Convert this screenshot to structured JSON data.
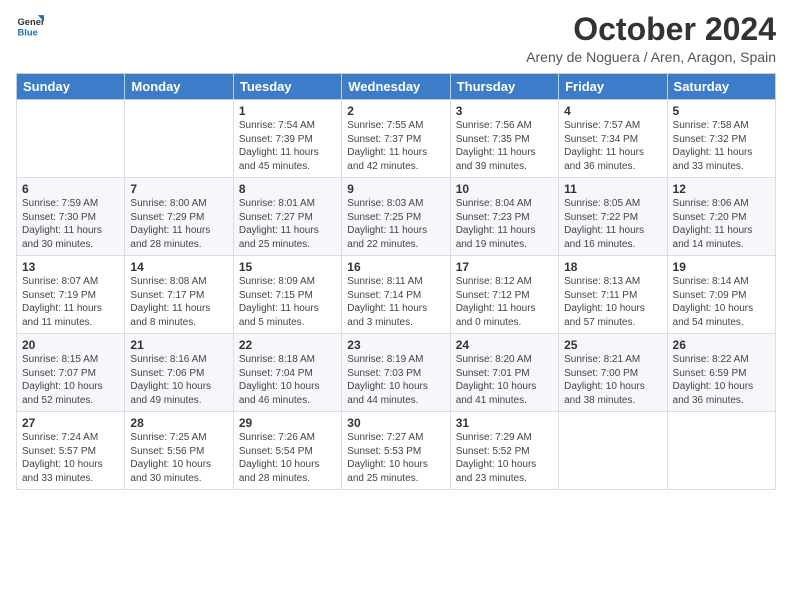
{
  "logo": {
    "line1": "General",
    "line2": "Blue"
  },
  "title": "October 2024",
  "subtitle": "Areny de Noguera / Aren, Aragon, Spain",
  "days_of_week": [
    "Sunday",
    "Monday",
    "Tuesday",
    "Wednesday",
    "Thursday",
    "Friday",
    "Saturday"
  ],
  "weeks": [
    [
      {
        "day": "",
        "info": ""
      },
      {
        "day": "",
        "info": ""
      },
      {
        "day": "1",
        "info": "Sunrise: 7:54 AM\nSunset: 7:39 PM\nDaylight: 11 hours and 45 minutes."
      },
      {
        "day": "2",
        "info": "Sunrise: 7:55 AM\nSunset: 7:37 PM\nDaylight: 11 hours and 42 minutes."
      },
      {
        "day": "3",
        "info": "Sunrise: 7:56 AM\nSunset: 7:35 PM\nDaylight: 11 hours and 39 minutes."
      },
      {
        "day": "4",
        "info": "Sunrise: 7:57 AM\nSunset: 7:34 PM\nDaylight: 11 hours and 36 minutes."
      },
      {
        "day": "5",
        "info": "Sunrise: 7:58 AM\nSunset: 7:32 PM\nDaylight: 11 hours and 33 minutes."
      }
    ],
    [
      {
        "day": "6",
        "info": "Sunrise: 7:59 AM\nSunset: 7:30 PM\nDaylight: 11 hours and 30 minutes."
      },
      {
        "day": "7",
        "info": "Sunrise: 8:00 AM\nSunset: 7:29 PM\nDaylight: 11 hours and 28 minutes."
      },
      {
        "day": "8",
        "info": "Sunrise: 8:01 AM\nSunset: 7:27 PM\nDaylight: 11 hours and 25 minutes."
      },
      {
        "day": "9",
        "info": "Sunrise: 8:03 AM\nSunset: 7:25 PM\nDaylight: 11 hours and 22 minutes."
      },
      {
        "day": "10",
        "info": "Sunrise: 8:04 AM\nSunset: 7:23 PM\nDaylight: 11 hours and 19 minutes."
      },
      {
        "day": "11",
        "info": "Sunrise: 8:05 AM\nSunset: 7:22 PM\nDaylight: 11 hours and 16 minutes."
      },
      {
        "day": "12",
        "info": "Sunrise: 8:06 AM\nSunset: 7:20 PM\nDaylight: 11 hours and 14 minutes."
      }
    ],
    [
      {
        "day": "13",
        "info": "Sunrise: 8:07 AM\nSunset: 7:19 PM\nDaylight: 11 hours and 11 minutes."
      },
      {
        "day": "14",
        "info": "Sunrise: 8:08 AM\nSunset: 7:17 PM\nDaylight: 11 hours and 8 minutes."
      },
      {
        "day": "15",
        "info": "Sunrise: 8:09 AM\nSunset: 7:15 PM\nDaylight: 11 hours and 5 minutes."
      },
      {
        "day": "16",
        "info": "Sunrise: 8:11 AM\nSunset: 7:14 PM\nDaylight: 11 hours and 3 minutes."
      },
      {
        "day": "17",
        "info": "Sunrise: 8:12 AM\nSunset: 7:12 PM\nDaylight: 11 hours and 0 minutes."
      },
      {
        "day": "18",
        "info": "Sunrise: 8:13 AM\nSunset: 7:11 PM\nDaylight: 10 hours and 57 minutes."
      },
      {
        "day": "19",
        "info": "Sunrise: 8:14 AM\nSunset: 7:09 PM\nDaylight: 10 hours and 54 minutes."
      }
    ],
    [
      {
        "day": "20",
        "info": "Sunrise: 8:15 AM\nSunset: 7:07 PM\nDaylight: 10 hours and 52 minutes."
      },
      {
        "day": "21",
        "info": "Sunrise: 8:16 AM\nSunset: 7:06 PM\nDaylight: 10 hours and 49 minutes."
      },
      {
        "day": "22",
        "info": "Sunrise: 8:18 AM\nSunset: 7:04 PM\nDaylight: 10 hours and 46 minutes."
      },
      {
        "day": "23",
        "info": "Sunrise: 8:19 AM\nSunset: 7:03 PM\nDaylight: 10 hours and 44 minutes."
      },
      {
        "day": "24",
        "info": "Sunrise: 8:20 AM\nSunset: 7:01 PM\nDaylight: 10 hours and 41 minutes."
      },
      {
        "day": "25",
        "info": "Sunrise: 8:21 AM\nSunset: 7:00 PM\nDaylight: 10 hours and 38 minutes."
      },
      {
        "day": "26",
        "info": "Sunrise: 8:22 AM\nSunset: 6:59 PM\nDaylight: 10 hours and 36 minutes."
      }
    ],
    [
      {
        "day": "27",
        "info": "Sunrise: 7:24 AM\nSunset: 5:57 PM\nDaylight: 10 hours and 33 minutes."
      },
      {
        "day": "28",
        "info": "Sunrise: 7:25 AM\nSunset: 5:56 PM\nDaylight: 10 hours and 30 minutes."
      },
      {
        "day": "29",
        "info": "Sunrise: 7:26 AM\nSunset: 5:54 PM\nDaylight: 10 hours and 28 minutes."
      },
      {
        "day": "30",
        "info": "Sunrise: 7:27 AM\nSunset: 5:53 PM\nDaylight: 10 hours and 25 minutes."
      },
      {
        "day": "31",
        "info": "Sunrise: 7:29 AM\nSunset: 5:52 PM\nDaylight: 10 hours and 23 minutes."
      },
      {
        "day": "",
        "info": ""
      },
      {
        "day": "",
        "info": ""
      }
    ]
  ]
}
